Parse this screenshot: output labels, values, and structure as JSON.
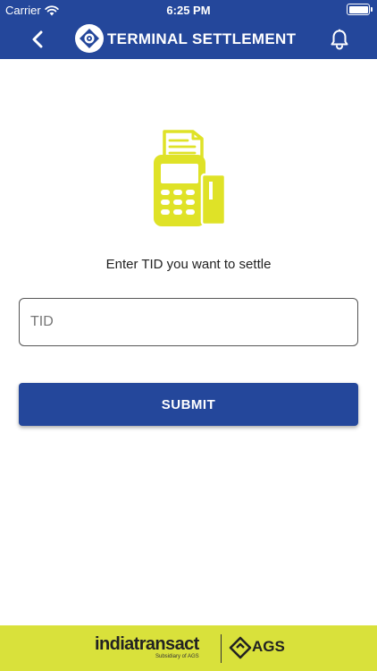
{
  "status_bar": {
    "carrier": "Carrier",
    "time": "6:25 PM"
  },
  "header": {
    "title": "TERMINAL SETTLEMENT",
    "back_icon": "chevron-left-icon",
    "logo_icon": "compass-logo-icon",
    "notification_icon": "bell-icon"
  },
  "main": {
    "illustration_icon": "pos-terminal-icon",
    "prompt": "Enter TID you want to settle",
    "tid_input": {
      "placeholder": "TID",
      "value": ""
    },
    "submit_label": "SUBMIT"
  },
  "footer": {
    "brand_name": "indiatransact",
    "brand_tagline": "Subsidiary of AGS",
    "partner_name": "AGS"
  },
  "colors": {
    "primary": "#24479b",
    "accent_yellow": "#d9e13b",
    "background": "#ffffff"
  }
}
